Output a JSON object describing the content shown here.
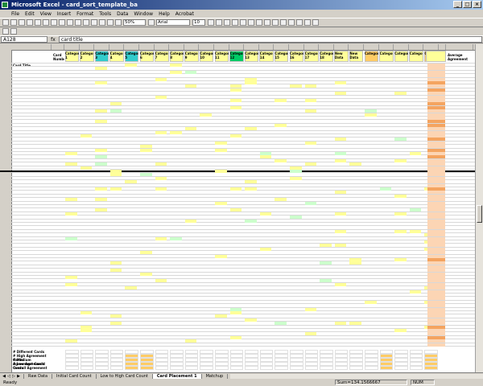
{
  "window": {
    "title": "Microsoft Excel - card_sort_template_ba"
  },
  "menu": [
    "File",
    "Edit",
    "View",
    "Insert",
    "Format",
    "Tools",
    "Data",
    "Window",
    "Help",
    "Acrobat"
  ],
  "toolbar": {
    "zoom": "50%",
    "font": "Arial",
    "font_size": "10"
  },
  "formula_bar": {
    "name_box": "A128",
    "fx": "fx",
    "content": "card title"
  },
  "headers": {
    "card_title": "Card Title",
    "card_num": "Card Number",
    "categories": [
      "Category 1",
      "Category 2",
      "Category 3",
      "Category 4",
      "Category 5",
      "Category 6",
      "Category 7",
      "Category 8",
      "Category 9",
      "Category 10",
      "Category 11",
      "Category 12",
      "Category 13",
      "Category 14",
      "Category 15",
      "Category 16",
      "Category 17",
      "Category 18",
      "New Data",
      "New Data",
      "Category",
      "Category",
      "Category",
      "Category",
      "Category"
    ],
    "total": "Total Category",
    "avg": "Average Agreement"
  },
  "summary_labels": [
    "# Different Cards",
    "# High Agreement Cards",
    "# Medium Agreement Cards",
    "# Low Agreement Cards",
    "Overall Agreement"
  ],
  "sheet_tabs": [
    "Raw Data",
    "Initial Card Count",
    "Low to High Card Count",
    "Card Placement 1",
    "Matchup"
  ],
  "active_tab_index": 3,
  "status": {
    "ready": "Ready",
    "sum": "Sum=134.1566667",
    "num": "NUM"
  },
  "colors": {
    "title_start": "#0a246a",
    "title_end": "#a6caf0",
    "cell_yellow": "#ffff99",
    "cell_green": "#ccffcc",
    "cell_orange": "#fcd5b4",
    "cell_dark_orange": "#f4a460",
    "header_teal": "#33cccc",
    "header_green": "#00cc66",
    "header_orange": "#ffcc66"
  }
}
